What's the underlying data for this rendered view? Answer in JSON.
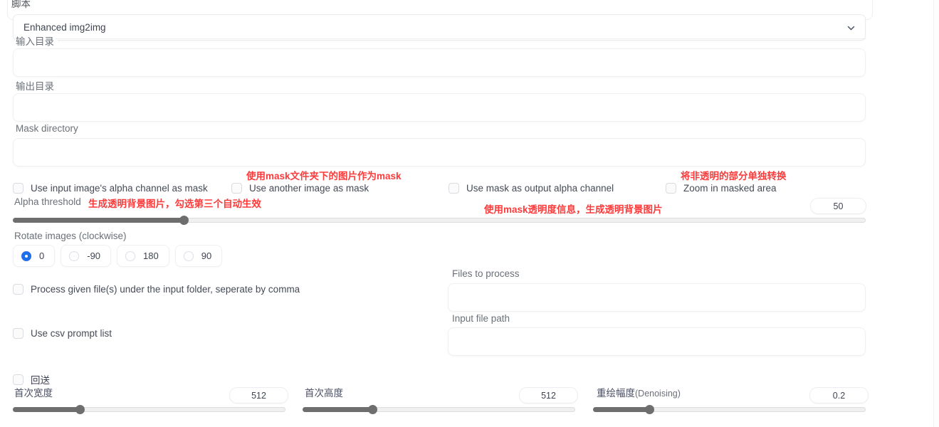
{
  "script_section": {
    "legend": "脚本",
    "dropdown": {
      "value": "Enhanced img2img",
      "chevron_icon": "chevron-down-icon"
    }
  },
  "fields": [
    {
      "label": "输入目录",
      "value": "",
      "placeholder": ""
    },
    {
      "label": "输出目录",
      "value": "",
      "placeholder": ""
    },
    {
      "label": "Mask directory",
      "value": "",
      "placeholder": ""
    }
  ],
  "mask_checkboxes": [
    {
      "label": "Use input image's alpha channel as mask",
      "checked": false
    },
    {
      "label": "Use another image as mask",
      "checked": false
    },
    {
      "label": "Use mask as output alpha channel",
      "checked": false
    },
    {
      "label": "Zoom in masked area",
      "checked": false
    }
  ],
  "annotations": [
    {
      "text": "使用mask文件夹下的图片作为mask"
    },
    {
      "text": "将非透明的部分单独转换"
    },
    {
      "text": "生成透明背景图片，勾选第三个自动生效"
    },
    {
      "text": "使用mask透明度信息，生成透明背景图片"
    }
  ],
  "alpha_threshold": {
    "label": "Alpha threshold",
    "value": "50",
    "fill_percent": 20
  },
  "rotate": {
    "label": "Rotate images (clockwise)",
    "options": [
      {
        "label": "0",
        "selected": true
      },
      {
        "label": "-90",
        "selected": false
      },
      {
        "label": "180",
        "selected": false
      },
      {
        "label": "90",
        "selected": false
      }
    ]
  },
  "process_files": {
    "checkbox_label": "Process given file(s) under the input folder, seperate by comma",
    "checked": false,
    "files_label": "Files to process",
    "files_value": "",
    "input_path_label": "Input file path",
    "input_path_value": ""
  },
  "csv_prompt": {
    "label": "Use csv prompt list",
    "checked": false
  },
  "loopback": {
    "label": "回送",
    "checked": false
  },
  "bottom_sliders": [
    {
      "label": "首次宽度",
      "label_sub": "",
      "value": "512",
      "fill_percent": 24.5
    },
    {
      "label": "首次高度",
      "label_sub": "",
      "value": "512",
      "fill_percent": 25.5
    },
    {
      "label": "重绘幅度",
      "label_sub": "(Denoising)",
      "value": "0.2",
      "fill_percent": 20.5
    }
  ],
  "colors": {
    "accent": "#1f6feb",
    "annotation": "#fb3b3b",
    "slider_fill": "#6e6e6e",
    "border": "#eef0f3"
  }
}
